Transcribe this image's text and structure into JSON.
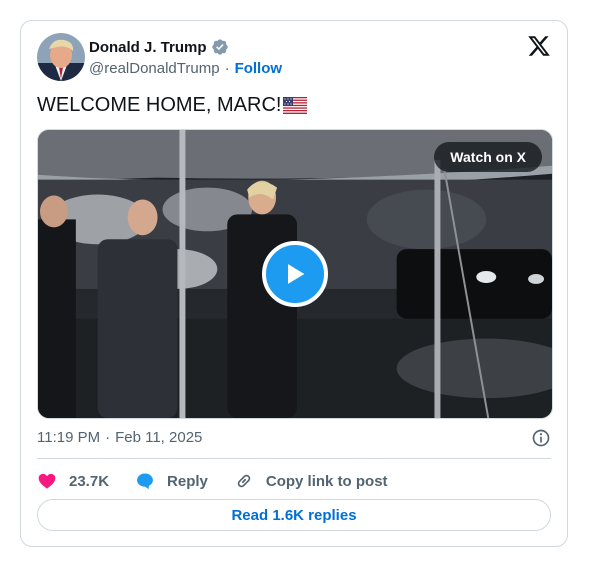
{
  "author": {
    "name": "Donald J. Trump",
    "handle": "@realDonaldTrump",
    "separator": "·",
    "follow_label": "Follow",
    "verified_color": "#829aab"
  },
  "tweet": {
    "text": "WELCOME HOME, MARC!",
    "emoji": "us-flag"
  },
  "media": {
    "watch_label": "Watch on X",
    "play_icon": "play-icon"
  },
  "meta": {
    "time": "11:19 PM",
    "separator": "·",
    "date": "Feb 11, 2025"
  },
  "actions": {
    "likes": "23.7K",
    "reply_label": "Reply",
    "copy_label": "Copy link to post",
    "read_replies": "Read 1.6K replies"
  },
  "colors": {
    "accent": "#1d9bf0",
    "link": "#006fd6",
    "like": "#f91880",
    "muted": "#536471",
    "border": "#cfd9de"
  }
}
